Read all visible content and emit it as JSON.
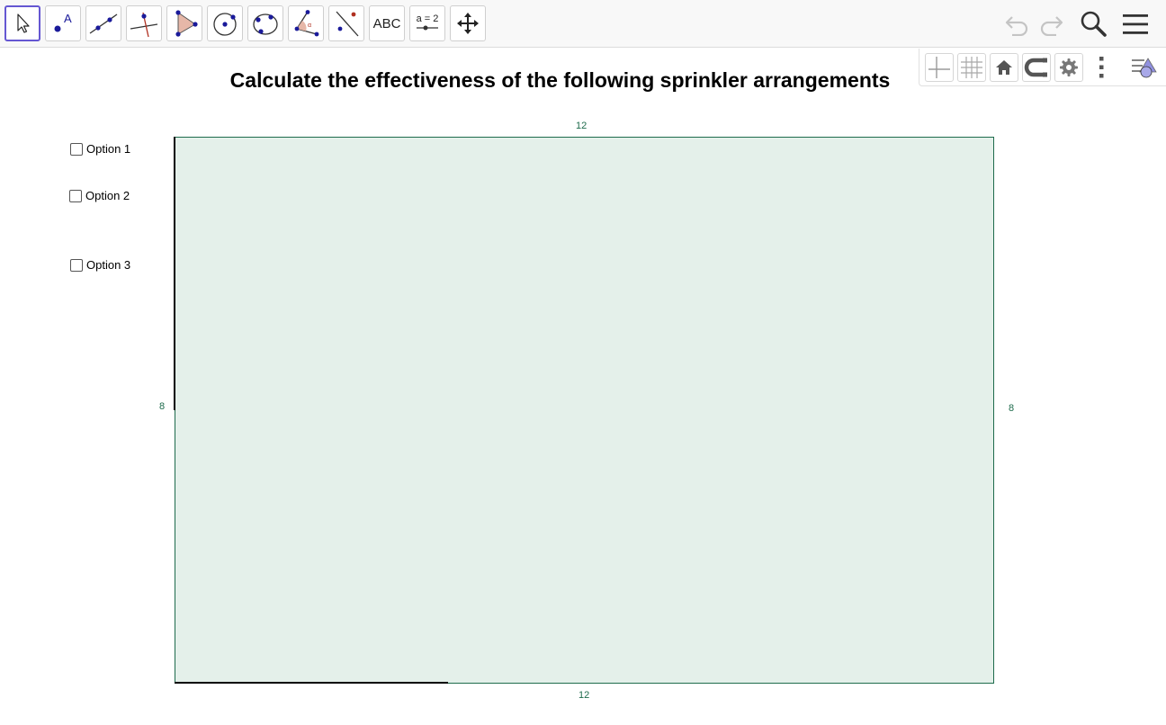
{
  "toolbar": {
    "tools": [
      {
        "name": "move-tool",
        "icon": "arrow-cursor-icon"
      },
      {
        "name": "point-tool",
        "icon": "point-icon",
        "text": "A"
      },
      {
        "name": "line-tool",
        "icon": "line-through-points-icon"
      },
      {
        "name": "perpendicular-line-tool",
        "icon": "perpendicular-line-icon"
      },
      {
        "name": "polygon-tool",
        "icon": "polygon-icon"
      },
      {
        "name": "circle-tool",
        "icon": "circle-center-point-icon"
      },
      {
        "name": "conic-tool",
        "icon": "circle-three-points-icon"
      },
      {
        "name": "angle-tool",
        "icon": "angle-icon"
      },
      {
        "name": "reflect-tool",
        "icon": "reflect-about-line-icon"
      },
      {
        "name": "text-tool",
        "icon": "text-icon",
        "text": "ABC"
      },
      {
        "name": "slider-tool",
        "icon": "slider-icon",
        "text": "a = 2"
      },
      {
        "name": "move-graphics-tool",
        "icon": "move-arrows-icon"
      }
    ],
    "selected_tool": "move-tool",
    "accent": "#6557d2"
  },
  "canvas": {
    "title": "Calculate the effectiveness of the following sprinkler arrangements",
    "options": [
      {
        "label": "Option 1",
        "checked": false
      },
      {
        "label": "Option 2",
        "checked": false
      },
      {
        "label": "Option 3",
        "checked": false
      }
    ],
    "field": {
      "fill": "#e4f0ea",
      "stroke": "#1e6b4c",
      "top_label": "12",
      "bottom_label": "12",
      "left_label": "8",
      "right_label": "8"
    }
  }
}
